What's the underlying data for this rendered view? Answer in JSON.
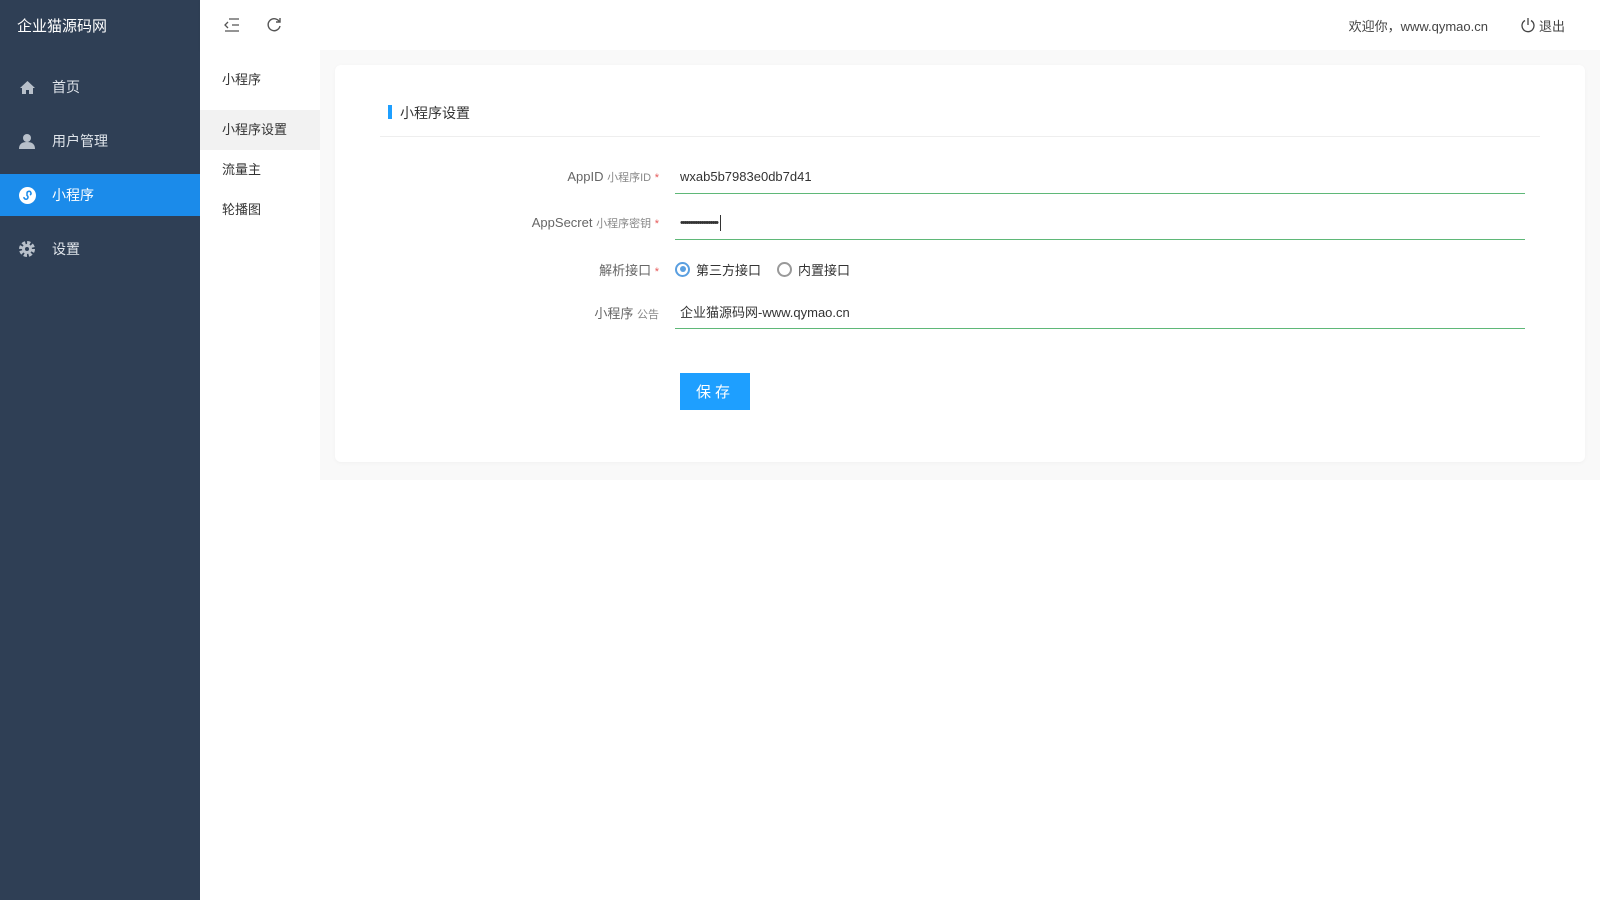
{
  "sidebar": {
    "logo": "企业猫源码网",
    "items": [
      {
        "label": "首页",
        "icon": "home-icon"
      },
      {
        "label": "用户管理",
        "icon": "user-icon"
      },
      {
        "label": "小程序",
        "icon": "miniprogram-icon"
      },
      {
        "label": "设置",
        "icon": "gear-icon"
      }
    ],
    "active": 2
  },
  "header": {
    "welcome": "欢迎你，www.qymao.cn",
    "logout": "退出"
  },
  "submenu": {
    "title": "小程序",
    "items": [
      "小程序设置",
      "流量主",
      "轮播图"
    ]
  },
  "card": {
    "title": "小程序设置",
    "fields": {
      "appid": {
        "label": "AppID",
        "sub": "小程序ID",
        "required": "*",
        "value": "wxab5b7983e0db7d41"
      },
      "secret": {
        "label": "AppSecret",
        "sub": "小程序密钥",
        "required": "*",
        "value": "••••••••••••••••••••"
      },
      "api": {
        "label": "解析接口",
        "required": "*",
        "options": [
          "第三方接口",
          "内置接口"
        ],
        "selected": 0
      },
      "notice": {
        "label": "小程序",
        "sub": "公告",
        "value": "企业猫源码网-www.qymao.cn"
      }
    },
    "save": "保存"
  },
  "colors": {
    "sidebar": "#2f3f55",
    "active": "#1b8bea",
    "accent": "#1e9fff",
    "underline": "#5fb878"
  }
}
